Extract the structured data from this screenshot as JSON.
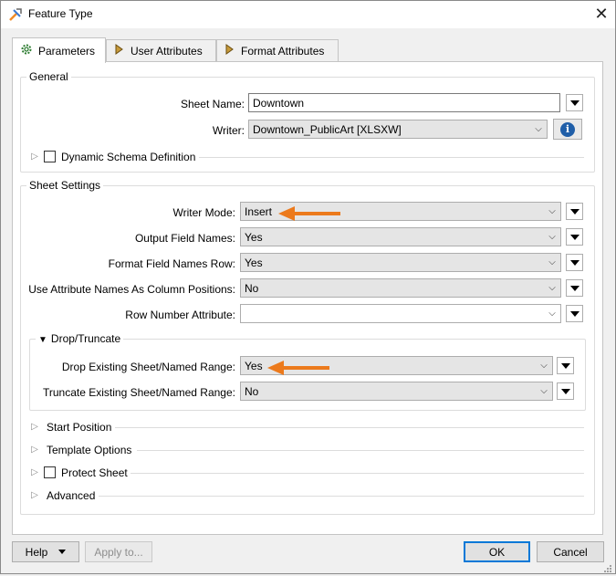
{
  "window": {
    "title": "Feature Type",
    "close_glyph": "✕"
  },
  "tabs": [
    {
      "label": "Parameters",
      "icon": "gear-icon",
      "active": true
    },
    {
      "label": "User Attributes",
      "icon": "attribute-arrow-icon"
    },
    {
      "label": "Format Attributes",
      "icon": "attribute-arrow-icon"
    }
  ],
  "general": {
    "legend": "General",
    "sheet_name_label": "Sheet Name:",
    "sheet_name_value": "Downtown",
    "writer_label": "Writer:",
    "writer_value": "Downtown_PublicArt [XLSXW]",
    "info_glyph": "i",
    "dynamic_schema_label": "Dynamic Schema Definition"
  },
  "sheet_settings": {
    "legend": "Sheet Settings",
    "writer_mode_label": "Writer Mode:",
    "writer_mode_value": "Insert",
    "output_field_names_label": "Output Field Names:",
    "output_field_names_value": "Yes",
    "format_field_names_row_label": "Format Field Names Row:",
    "format_field_names_row_value": "Yes",
    "use_attr_names_label": "Use Attribute Names As Column Positions:",
    "use_attr_names_value": "No",
    "row_number_attr_label": "Row Number Attribute:",
    "row_number_attr_value": ""
  },
  "drop_truncate": {
    "legend": "Drop/Truncate",
    "drop_existing_label": "Drop Existing Sheet/Named Range:",
    "drop_existing_value": "Yes",
    "truncate_existing_label": "Truncate Existing Sheet/Named Range:",
    "truncate_existing_value": "No"
  },
  "collapsed_sections": {
    "start_position": "Start Position",
    "template_options": "Template Options",
    "protect_sheet": "Protect Sheet",
    "advanced": "Advanced"
  },
  "footer": {
    "help": "Help",
    "apply_to": "Apply to...",
    "ok": "OK",
    "cancel": "Cancel"
  },
  "colors": {
    "annotation_arrow": "#ec7a1c",
    "info_blue": "#1f5ea8",
    "default_button_border": "#0078d7"
  }
}
